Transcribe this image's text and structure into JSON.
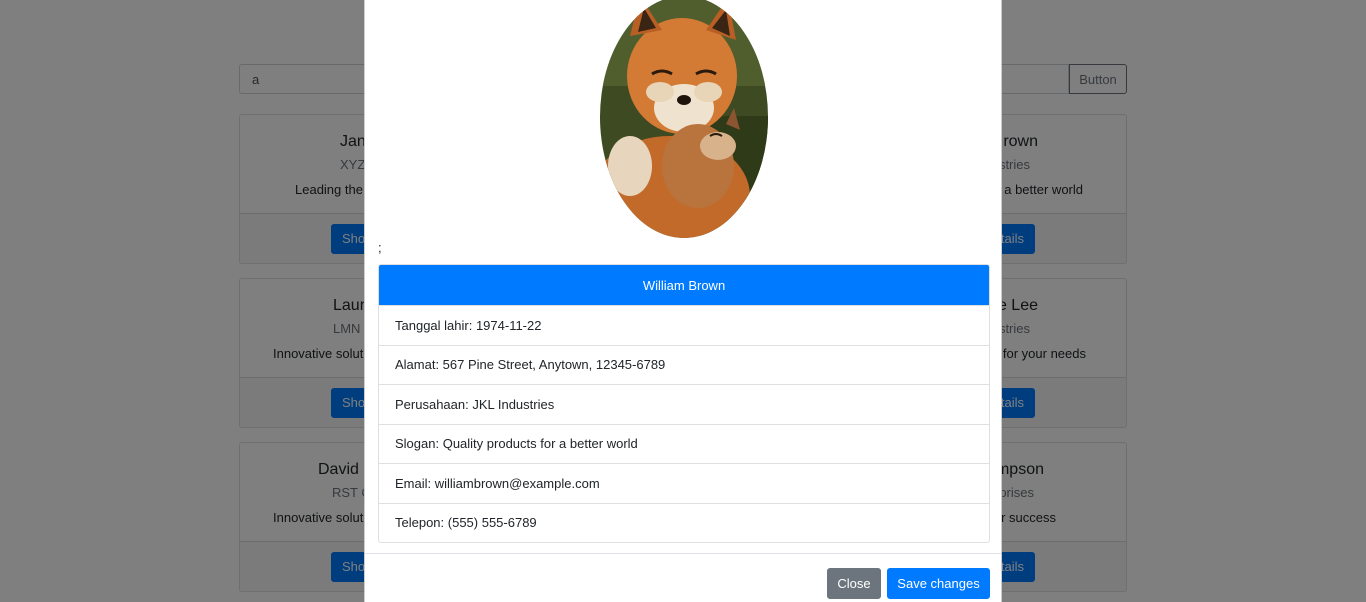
{
  "search": {
    "value": "a",
    "button_label": "Button"
  },
  "cards": [
    {
      "title": "Jan",
      "company": "XYZ C",
      "slogan": "Leading the",
      "button_label": "Sho"
    },
    {
      "title": "rown",
      "company": "stries",
      "slogan": "a better world",
      "button_label": "tails"
    },
    {
      "title": "Laur",
      "company": "LMN C",
      "slogan": "Innovative soluti",
      "button_label": "Sho"
    },
    {
      "title": "e Lee",
      "company": "stries",
      "slogan": "for your needs",
      "button_label": "tails"
    },
    {
      "title": "David",
      "company": "RST C",
      "slogan": "Innovative soluti",
      "button_label": "Sho"
    },
    {
      "title": "mpson",
      "company": "rprises",
      "slogan": "r success",
      "button_label": "tails"
    }
  ],
  "modal": {
    "photo_icon": "fox-photo",
    "stray_text": ";",
    "header_name": "William Brown",
    "details": [
      "Tanggal lahir: 1974-11-22",
      "Alamat: 567 Pine Street, Anytown, 12345-6789",
      "Perusahaan: JKL Industries",
      "Slogan: Quality products for a better world",
      "Email: williambrown@example.com",
      "Telepon: (555) 555-6789"
    ],
    "close_label": "Close",
    "save_label": "Save changes"
  }
}
